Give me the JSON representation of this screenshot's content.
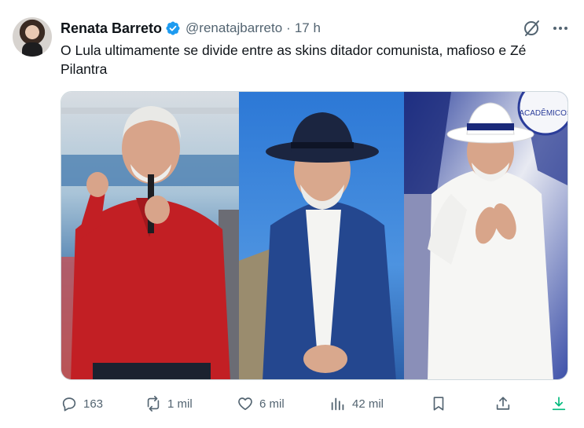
{
  "author": {
    "name": "Renata Barreto",
    "handle": "@renatajbarreto",
    "separator": "·",
    "time": "17 h"
  },
  "tweet": {
    "text": "O Lula ultimamente se divide entre as skins ditador comunista, mafioso e Zé Pilantra"
  },
  "media": {
    "panels": [
      "red-shirt-microphone-photo",
      "dark-hat-blue-suit-photo",
      "white-hat-white-outfit-photo"
    ],
    "badge_text": "ACADÊMICOS"
  },
  "actions": {
    "replies": "163",
    "reposts": "1 mil",
    "likes": "6 mil",
    "views": "42 mil"
  },
  "colors": {
    "verified": "#1d9bf0",
    "icon_gray": "#536471",
    "download_green": "#00ba7c"
  }
}
